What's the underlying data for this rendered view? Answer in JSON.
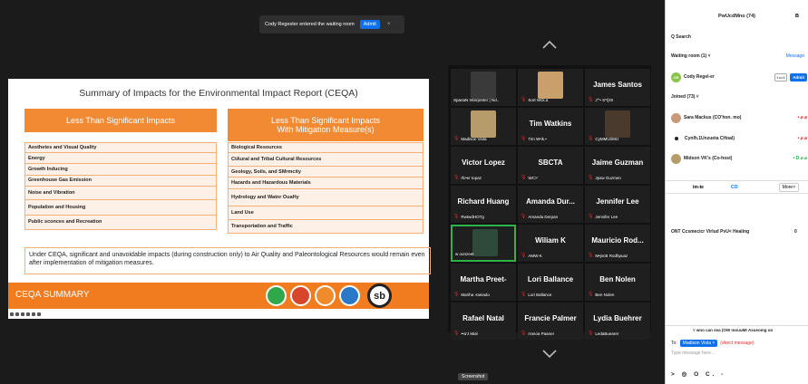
{
  "notification": {
    "message": "Cody Regester entered the waiting room",
    "admit_label": "Admit",
    "close": "×"
  },
  "slide": {
    "title": "Summary of Impacts for the Environmental Impact Report (CEQA)",
    "left_header": "Less Than Significant Impacts",
    "right_header_line1": "Less Than Significant Impacts",
    "right_header_line2": "With Mitigation Measure(s)",
    "left_items": [
      "Aesthetes and Visual Quality",
      "Energy",
      "Growth Inducing",
      "Greenhouse Gas Emission",
      "Noise and Vibration",
      "Population and Housing",
      "Public sconces and Recreation"
    ],
    "right_items": [
      "Biological Resources",
      "CtAural and Tribal Cultural Resources",
      "Geology, Soils, and SMrmcity",
      "Hazards and Hazardous Materials",
      "Hydrology and Watnr OuaHy",
      "Land Use",
      "Transportation and Traffic"
    ],
    "note": "Under CEQA, significant and unavoidable impacts (during construction only) to Air Quality and Paleontological Resources would remain even after implementation of mitigation measures.",
    "footer_label": "CEQA SUMMARY",
    "logo_text": "sb"
  },
  "gallery": {
    "tiles": [
      {
        "big": "",
        "small": "SpanaN Interpreter | Nd..",
        "mic": false,
        "photo": "#3a3a3a"
      },
      {
        "big": "",
        "small": "Sort Wck.a",
        "mic": true,
        "photo": "#c9a06c"
      },
      {
        "big": "James Santos",
        "small": "J°'• S*I}OI",
        "mic": true,
        "photo": ""
      },
      {
        "big": "",
        "small": "Madison Viola",
        "mic": true,
        "photo": "#b79c6b"
      },
      {
        "big": "Tim Watkins",
        "small": "Tim W•ik.•",
        "mic": true,
        "photo": ""
      },
      {
        "big": "",
        "small": "CyMMUriMU",
        "mic": true,
        "photo": "#4a3a2e"
      },
      {
        "big": "Victor Lopez",
        "small": "Ifc•er topaz",
        "mic": true,
        "photo": ""
      },
      {
        "big": "SBCTA",
        "small": "WC>'",
        "mic": true,
        "photo": ""
      },
      {
        "big": "Jaime Guzman",
        "small": "Jpsw Guzmen",
        "mic": true,
        "photo": ""
      },
      {
        "big": "Richard Huang",
        "small": "RwtwdHOTg",
        "mic": true,
        "photo": ""
      },
      {
        "big": "Amanda Dur...",
        "small": "Amanda Derpan",
        "mic": true,
        "photo": ""
      },
      {
        "big": "Jennifer Lee",
        "small": "Jennifer Lee",
        "mic": true,
        "photo": ""
      },
      {
        "big": "",
        "small": "w oonzeet",
        "mic": false,
        "photo": "#2f4a3a"
      },
      {
        "big": "Wiliam K",
        "small": "AMW-K",
        "mic": true,
        "photo": ""
      },
      {
        "big": "Mauricio Rod...",
        "small": "M•jncB Rodhpuaz",
        "mic": true,
        "photo": ""
      },
      {
        "big": "Martha Preet-",
        "small": "Mariha ›raeiado",
        "mic": true,
        "photo": ""
      },
      {
        "big": "Lori Ballance",
        "small": "Lori Ballance",
        "mic": true,
        "photo": ""
      },
      {
        "big": "Ben Nolen",
        "small": "Ben Nolen",
        "mic": true,
        "photo": ""
      },
      {
        "big": "Rafael Natal",
        "small": "••a'J Mial",
        "mic": true,
        "photo": ""
      },
      {
        "big": "Francie Palmer",
        "small": "rranoa Paaner",
        "mic": true,
        "photo": ""
      },
      {
        "big": "Lydia Buehrer",
        "small": "LedaBuearer",
        "mic": true,
        "photo": ""
      }
    ]
  },
  "screenshot_tip": "Screenshot",
  "panel": {
    "title": "PwUcdMno (74)",
    "title_right": "B",
    "search": "Q Search",
    "waiting": "Waiting room (1) ˅",
    "message_link": "Message",
    "waiting_person": {
      "initials": "CR",
      "name": "Cody Regel-er",
      "remove": "I ••• I",
      "admit": "Admit"
    },
    "joined": "Joined (73) ˅",
    "participants": [
      {
        "name": "Sara Mackus (CO'hon. mo)",
        "icons": "• ⌀ ⌀"
      },
      {
        "name": "Cynlh.1Unzueta CHoal)",
        "icons": "• ⌀ ⌀"
      },
      {
        "name": "Midson VK's (Co-host)",
        "icons": "• D ⌀ ⌀"
      }
    ],
    "foot_invite": "im-te",
    "foot_cc": "CO",
    "foot_more": "More˅",
    "cc_line": "ONT Ccsmecicr Virlud PvU< Healing",
    "cc_count": "0",
    "chat_line": "˅ wno can sea (OW mouuMt  Asueomg on",
    "to_label": "To:",
    "to_person": "Madison Viola ˅",
    "direct": "(direct message)",
    "input_placeholder": "Type message here...",
    "tools": "> ◎ O C. -"
  }
}
